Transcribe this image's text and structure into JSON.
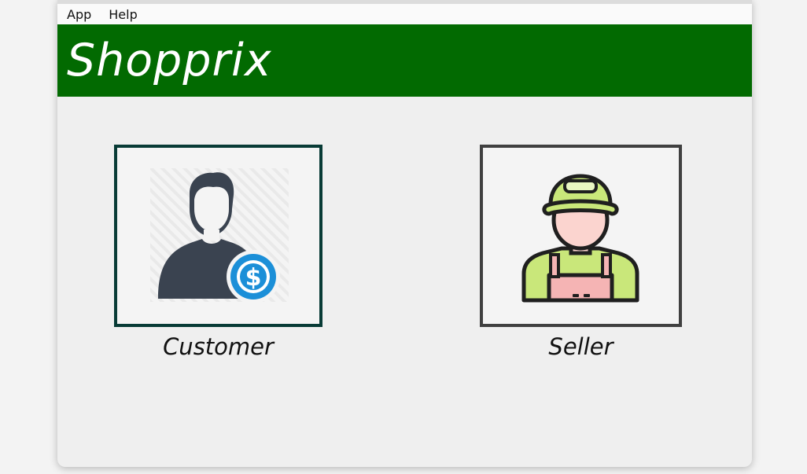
{
  "menubar": {
    "items": [
      {
        "label": "App"
      },
      {
        "label": "Help"
      }
    ]
  },
  "banner": {
    "title": "Shopprix",
    "color": "#026a01"
  },
  "roles": {
    "customer": {
      "label": "Customer",
      "icon": "customer-dollar-icon"
    },
    "seller": {
      "label": "Seller",
      "icon": "seller-worker-icon"
    }
  }
}
